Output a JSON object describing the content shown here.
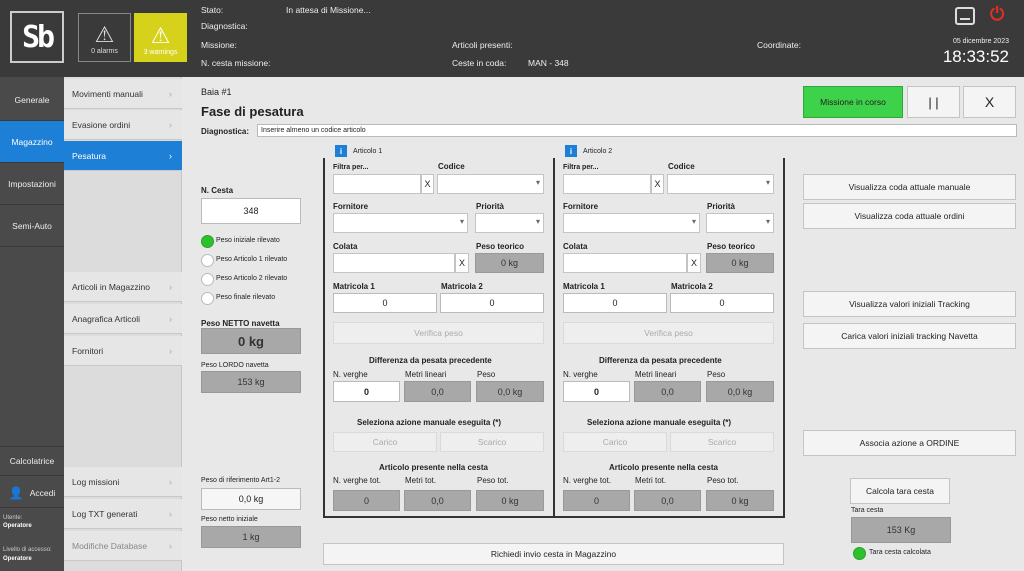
{
  "logo": {
    "text": "Sb"
  },
  "alerts": {
    "alarms": "0 alarms",
    "warnings": "3 warnings"
  },
  "status": {
    "stato_label": "Stato:",
    "stato_value": "In attesa di Missione...",
    "diagnostica_label": "Diagnostica:",
    "missione_label": "Missione:",
    "ncesta_label": "N. cesta missione:",
    "articoli_label": "Articoli presenti:",
    "ceste_label": "Ceste in coda:",
    "ceste_value": "MAN - 348",
    "coordinate_label": "Coordinate:"
  },
  "clock": {
    "date": "05 dicembre 2023",
    "time": "18:33:52"
  },
  "leftnav": {
    "generale": "Generale",
    "magazzino": "Magazzino",
    "impostazioni": "Impostazioni",
    "semiauto": "Semi-Auto",
    "calcolatrice": "Calcolatrice",
    "accedi": "Accedi",
    "utente_label": "Utente:",
    "utente_value": "Operatore",
    "livello_label": "Livello di accesso:",
    "livello_value": "Operatore"
  },
  "subnav": {
    "movimenti": "Movimenti manuali",
    "evasione": "Evasione ordini",
    "pesatura": "Pesatura",
    "articoli_mag": "Articoli in Magazzino",
    "anagrafica": "Anagrafica Articoli",
    "fornitori": "Fornitori",
    "log_missioni": "Log missioni",
    "log_txt": "Log TXT generati",
    "modifiche": "Modifiche Database"
  },
  "header": {
    "baia": "Baia #1",
    "title": "Fase di pesatura",
    "diag_label": "Diagnostica:",
    "diag_value": "Inserire almeno un codice articolo"
  },
  "mission": {
    "status": "Missione in corso",
    "pause": "| |",
    "close": "X"
  },
  "left": {
    "ncesta_label": "N. Cesta",
    "ncesta_value": "348",
    "checks": [
      "Peso iniziale rilevato",
      "Peso Articolo 1 rilevato",
      "Peso Articolo 2 rilevato",
      "Peso finale rilevato"
    ],
    "netto_label": "Peso NETTO navetta",
    "netto_value": "0 kg",
    "lordo_label": "Peso LORDO navetta",
    "lordo_value": "153 kg",
    "rif_label": "Peso di riferimento Art1-2",
    "rif_value": "0,0 kg",
    "netto_iniz_label": "Peso netto iniziale",
    "netto_iniz_value": "1 kg"
  },
  "article_common": {
    "filtra": "Filtra per...",
    "codice": "Codice",
    "fornitore": "Fornitore",
    "priorita": "Priorità",
    "colata": "Colata",
    "peso_teorico": "Peso teorico",
    "matricola1": "Matricola 1",
    "matricola2": "Matricola 2",
    "verifica": "Verifica peso",
    "diff_title": "Differenza da pesata precedente",
    "nverghe": "N. verghe",
    "metri": "Metri lineari",
    "peso": "Peso",
    "azione_title": "Seleziona azione manuale eseguita (*)",
    "carico": "Carico",
    "scarico": "Scarico",
    "presente_title": "Articolo presente nella cesta",
    "nverghe_tot": "N. verghe tot.",
    "metri_tot": "Metri tot.",
    "peso_tot": "Peso tot.",
    "x": "X"
  },
  "articles": [
    {
      "title": "Articolo 1",
      "peso_teorico": "0 kg",
      "matr1": "0",
      "matr2": "0",
      "nverghe": "0",
      "metri": "0,0",
      "peso": "0,0 kg",
      "tot_nverghe": "0",
      "tot_metri": "0,0",
      "tot_peso": "0 kg"
    },
    {
      "title": "Articolo 2",
      "peso_teorico": "0 kg",
      "matr1": "0",
      "matr2": "0",
      "nverghe": "0",
      "metri": "0,0",
      "peso": "0,0 kg",
      "tot_nverghe": "0",
      "tot_metri": "0,0",
      "tot_peso": "0 kg"
    }
  ],
  "right": {
    "coda_manuale": "Visualizza coda attuale manuale",
    "coda_ordini": "Visualizza coda attuale ordini",
    "valori_tracking": "Visualizza valori iniziali Tracking",
    "carica_tracking": "Carica valori iniziali tracking Navetta",
    "associa": "Associa azione a ORDINE",
    "calcola_tara": "Calcola tara cesta",
    "tara_label": "Tara cesta",
    "tara_value": "153 Kg",
    "tara_calcolata": "Tara cesta calcolata"
  },
  "bottom": {
    "richiedi": "Richiedi invio cesta in Magazzino"
  },
  "colors": {
    "accent": "#1e7fd6",
    "mission_green": "#3ed14a",
    "warning": "#d6d21c"
  }
}
